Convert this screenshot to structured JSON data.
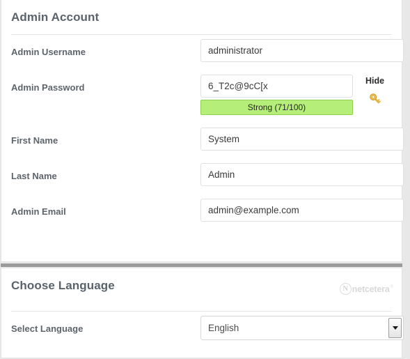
{
  "brand": {
    "mark_letter": "N",
    "name": "netcetera",
    "registered": "®",
    "color": "#d9d9d9"
  },
  "admin_section": {
    "title": "Admin Account",
    "fields": [
      {
        "label": "Admin Username",
        "value": "administrator",
        "placeholder": ""
      },
      {
        "label": "Admin Password",
        "value": "6_T2c@9cC[x",
        "placeholder": ""
      },
      {
        "label": "First Name",
        "value": "System",
        "placeholder": ""
      },
      {
        "label": "Last Name",
        "value": "Admin",
        "placeholder": ""
      },
      {
        "label": "Admin Email",
        "value": "admin@example.com",
        "placeholder": ""
      }
    ],
    "password_strength": {
      "text": "Strong (71/100)",
      "score": 71,
      "max": 100,
      "level": "Strong",
      "fill_color": "#b5ef79",
      "border_color": "#8fd04a"
    },
    "password_toggle_label": "Hide",
    "key_icon_name": "key-icon",
    "key_icon_color": "#e8b33c"
  },
  "language_section": {
    "title": "Choose Language",
    "field_label": "Select Language",
    "selected": "English",
    "options": [
      "English"
    ]
  }
}
